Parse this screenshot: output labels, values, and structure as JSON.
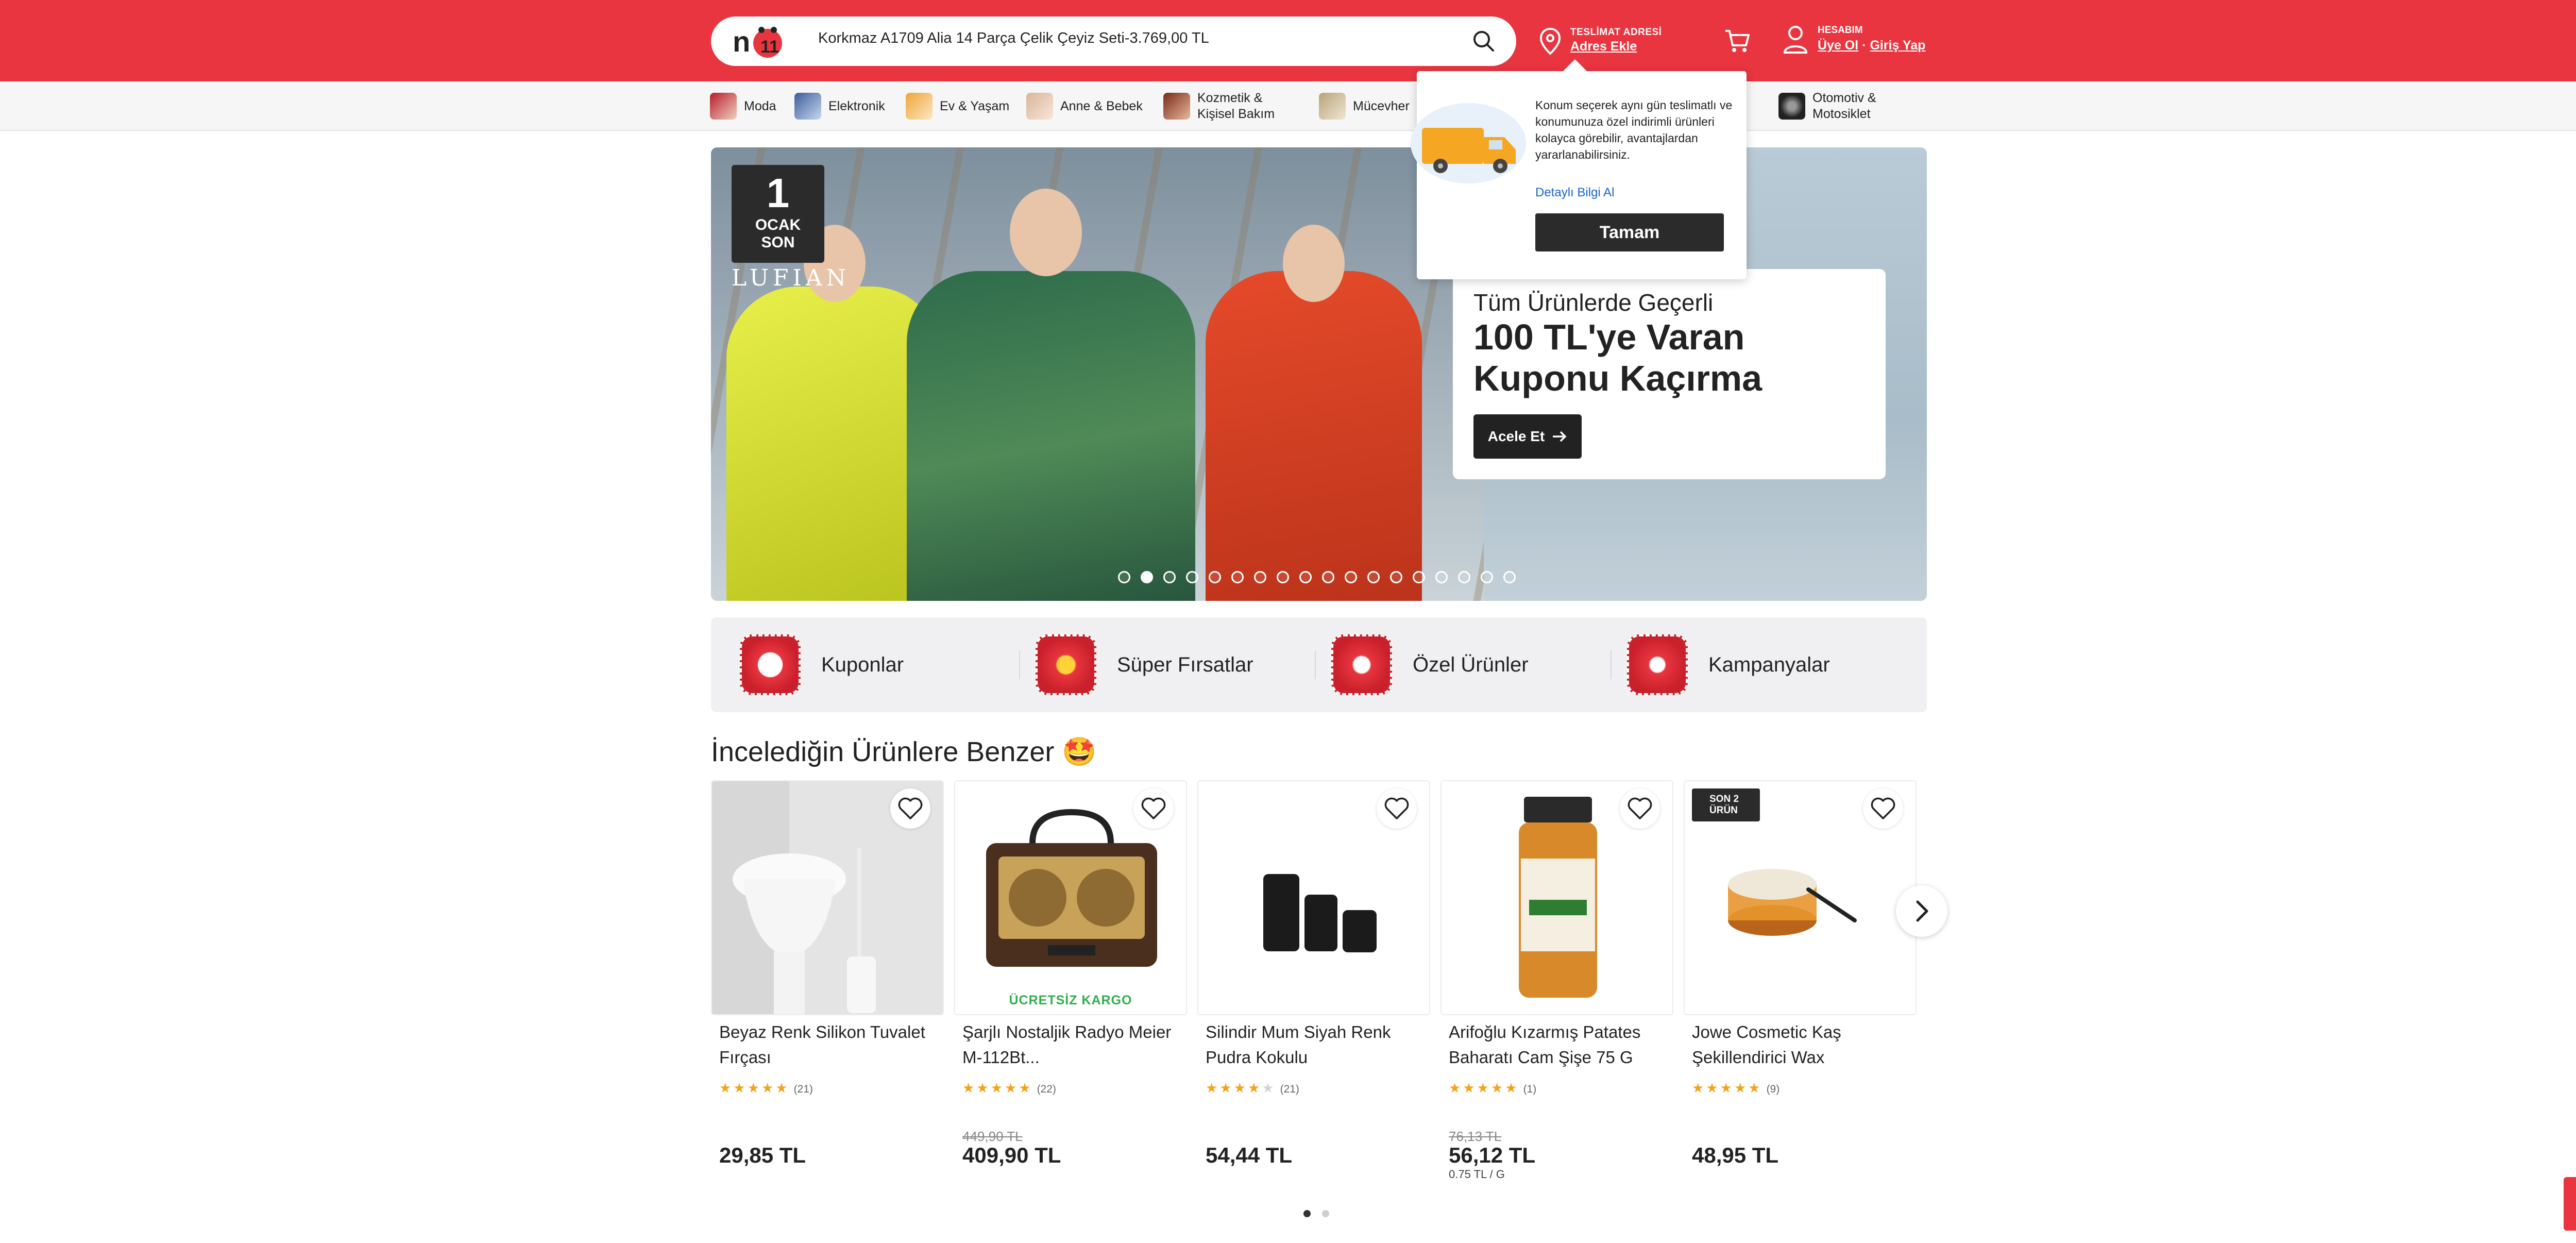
{
  "header": {
    "search_value": "Korkmaz A1709 Alia 14 Parça Çelik Çeyiz Seti-3.769,00 TL",
    "address_label": "TESLİMAT ADRESİ",
    "address_value": "Adres Ekle",
    "account_label": "HESABIM",
    "register": "Üye Ol",
    "separator": "·",
    "login": "Giriş Yap",
    "brand_color": "#e8353f"
  },
  "categories": [
    {
      "label": "Moda"
    },
    {
      "label": "Elektronik"
    },
    {
      "label": "Ev & Yaşam"
    },
    {
      "label": "Anne & Bebek"
    },
    {
      "label": "Kozmetik &\nKişisel Bakım"
    },
    {
      "label": "Mücevher"
    },
    {
      "label": "Otomotiv &\nMotosiklet"
    }
  ],
  "hero": {
    "badge_num": "1",
    "badge_line1": "OCAK",
    "badge_line2": "SON",
    "brand": "LUFIAN",
    "subtitle": "Tüm Ürünlerde Geçerli",
    "title": "100 TL'ye Varan Kuponu Kaçırma",
    "cta": "Acele Et",
    "slide_count": 18,
    "active_slide": 1
  },
  "popover": {
    "text": "Konum seçerek aynı gün teslimatlı ve konumunuza özel indirimli ürünleri kolayca görebilir, avantajlardan yararlanabilirsiniz.",
    "link": "Detaylı Bilgi Al",
    "button": "Tamam"
  },
  "quick_links": [
    {
      "label": "Kuponlar"
    },
    {
      "label": "Süper Fırsatlar"
    },
    {
      "label": "Özel Ürünler"
    },
    {
      "label": "Kampanyalar"
    }
  ],
  "section": {
    "title": "İncelediğin Ürünlere Benzer 🤩"
  },
  "products": [
    {
      "name": "Beyaz Renk Silikon Tuvalet Fırçası",
      "rating": 4.5,
      "reviews": "(21)",
      "old_price": "",
      "price": "29,85 TL",
      "unit_price": "",
      "badge": ""
    },
    {
      "name": "Şarjlı Nostaljik Radyo Meier M-112Bt...",
      "rating": 4.5,
      "reviews": "(22)",
      "old_price": "449,90 TL",
      "price": "409,90 TL",
      "unit_price": "",
      "badge": "ÜCRETSİZ KARGO"
    },
    {
      "name": "Silindir Mum Siyah Renk Pudra Kokulu",
      "rating": 4,
      "reviews": "(21)",
      "old_price": "",
      "price": "54,44 TL",
      "unit_price": "",
      "badge": ""
    },
    {
      "name": "Arifoğlu Kızarmış Patates Baharatı Cam Şişe 75 G",
      "rating": 5,
      "reviews": "(1)",
      "old_price": "76,13 TL",
      "price": "56,12 TL",
      "unit_price": "0.75 TL / G",
      "badge": ""
    },
    {
      "name": "Jowe Cosmetic Kaş Şekillendirici Wax",
      "rating": 5,
      "reviews": "(9)",
      "old_price": "",
      "price": "48,95 TL",
      "unit_price": "",
      "badge": "SON 2 ÜRÜN"
    }
  ],
  "carousel": {
    "pages": 2,
    "active_page": 1
  }
}
